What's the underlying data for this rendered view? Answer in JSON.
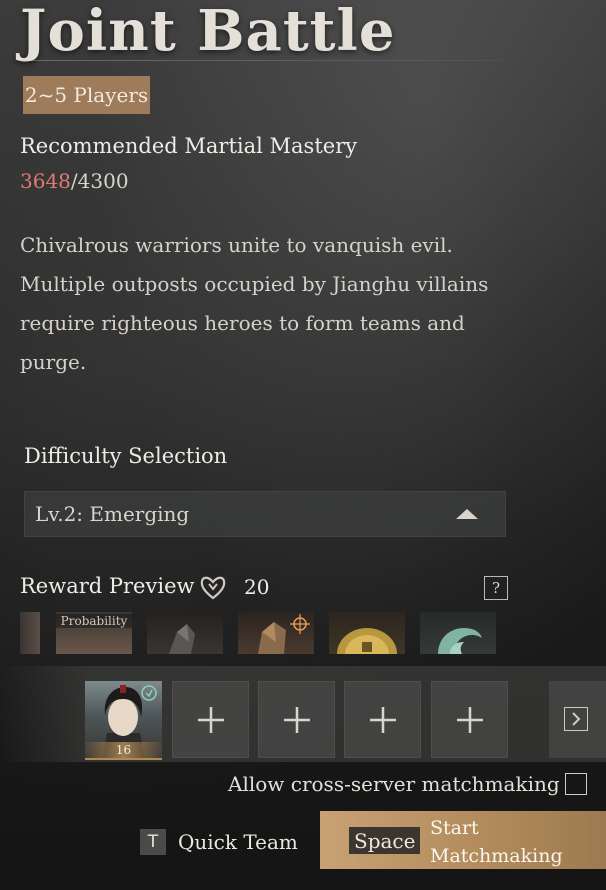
{
  "title": "Joint Battle",
  "players_badge": "2~5 Players",
  "mastery": {
    "label": "Recommended Martial Mastery",
    "current": "3648",
    "separator": "/",
    "required": "4300",
    "current_color": "#e07a72"
  },
  "description": "Chivalrous warriors unite to vanquish evil. Multiple outposts occupied by Jianghu villains require righteous heroes to form teams and purge.",
  "difficulty": {
    "label": "Difficulty Selection",
    "selected": "Lv.2: Emerging"
  },
  "rewards": {
    "label": "Reward Preview",
    "count": "20",
    "help": "?",
    "probability_tag": "Probability",
    "items": [
      "reward-item-partial",
      "reward-item-probability",
      "reward-item-stone",
      "reward-item-armor",
      "reward-item-coin",
      "reward-item-jade"
    ]
  },
  "team": {
    "leader_level": "16",
    "empty_slots": 4
  },
  "cross_server": {
    "label": "Allow cross-server matchmaking",
    "checked": false
  },
  "quick_team": {
    "key": "T",
    "label": "Quick Team"
  },
  "start": {
    "key": "Space",
    "label": "Start Matchmaking"
  },
  "colors": {
    "accent_gold": "#b08a5a",
    "badge_bg": "#9e7b5a"
  }
}
